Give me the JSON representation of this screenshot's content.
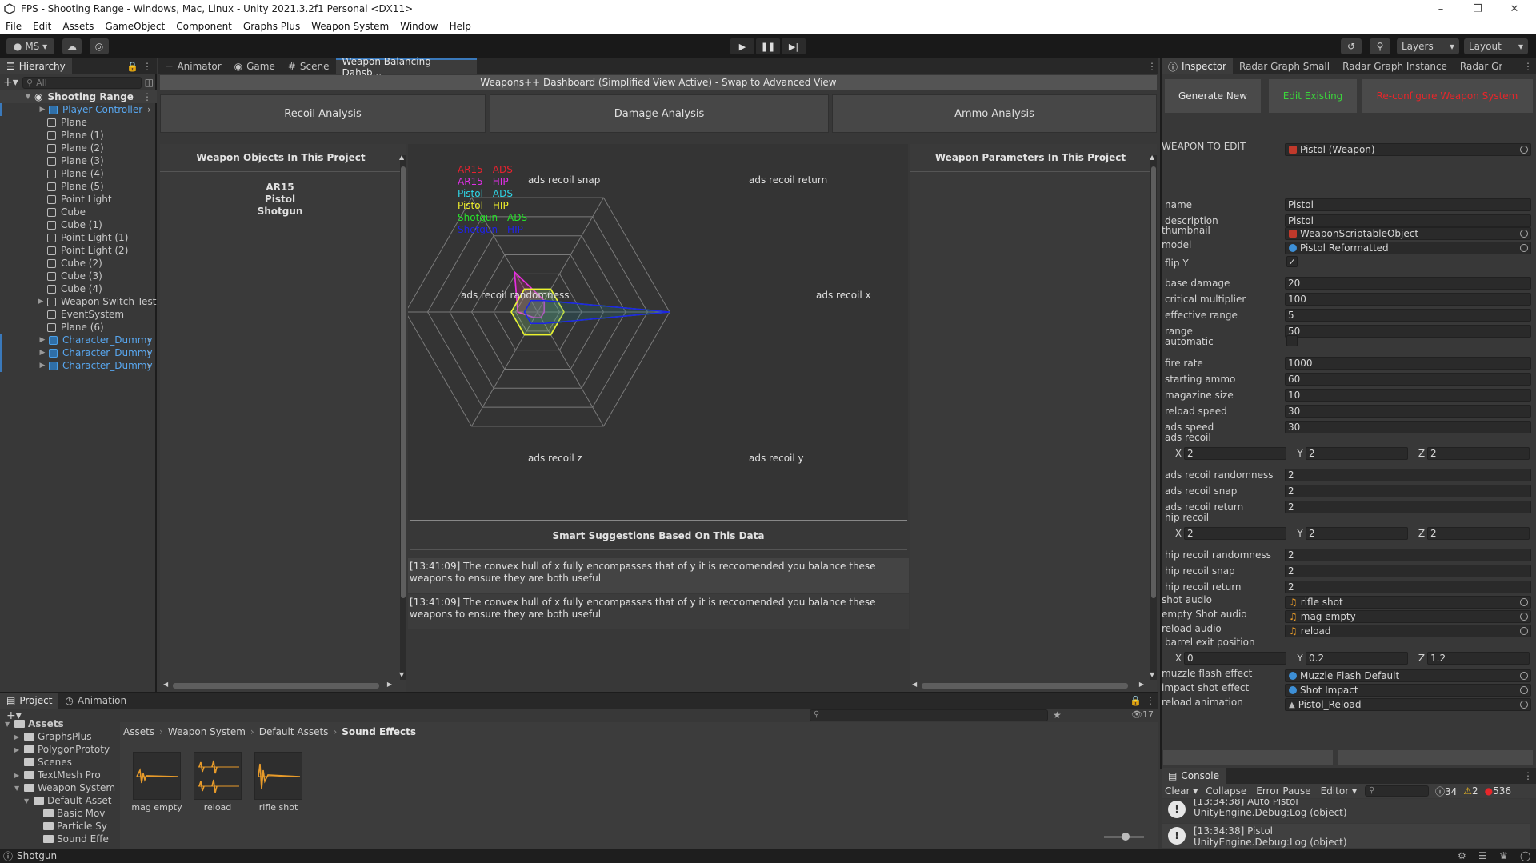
{
  "window": {
    "title": "FPS - Shooting Range - Windows, Mac, Linux - Unity 2021.3.2f1 Personal <DX11>",
    "controls": [
      "–",
      "❐",
      "✕"
    ]
  },
  "menu": [
    "File",
    "Edit",
    "Assets",
    "GameObject",
    "Component",
    "Graphs Plus",
    "Weapon System",
    "Window",
    "Help"
  ],
  "toolbar": {
    "account": "MS ▾",
    "layers": "Layers",
    "layout": "Layout"
  },
  "hierarchy": {
    "tab": "Hierarchy",
    "search_placeholder": "All",
    "root": "Shooting Range",
    "items": [
      {
        "label": "Player Controller",
        "blue": true,
        "arrow": true,
        "child": true
      },
      {
        "label": "Plane",
        "blue": false
      },
      {
        "label": "Plane (1)",
        "blue": false
      },
      {
        "label": "Plane (2)",
        "blue": false
      },
      {
        "label": "Plane (3)",
        "blue": false
      },
      {
        "label": "Plane (4)",
        "blue": false
      },
      {
        "label": "Plane (5)",
        "blue": false
      },
      {
        "label": "Point Light",
        "blue": false
      },
      {
        "label": "Cube",
        "blue": false
      },
      {
        "label": "Cube (1)",
        "blue": false
      },
      {
        "label": "Point Light (1)",
        "blue": false
      },
      {
        "label": "Point Light (2)",
        "blue": false
      },
      {
        "label": "Cube (2)",
        "blue": false
      },
      {
        "label": "Cube (3)",
        "blue": false
      },
      {
        "label": "Cube (4)",
        "blue": false
      },
      {
        "label": "Weapon Switch Test",
        "blue": false,
        "arrow": true
      },
      {
        "label": "EventSystem",
        "blue": false
      },
      {
        "label": "Plane (6)",
        "blue": false
      },
      {
        "label": "Character_Dummy",
        "blue": true,
        "arrow": true,
        "child": true
      },
      {
        "label": "Character_Dummy",
        "blue": true,
        "arrow": true,
        "child": true
      },
      {
        "label": "Character_Dummy",
        "blue": true,
        "arrow": true,
        "child": true
      }
    ]
  },
  "center_tabs": [
    "Animator",
    "Game",
    "Scene",
    "Weapon Balancing Dahsb..."
  ],
  "dashboard": {
    "banner": "Weapons++ Dashboard (Simplified View Active) - Swap to Advanced View",
    "buttons": [
      "Recoil Analysis",
      "Damage Analysis",
      "Ammo Analysis"
    ],
    "left_header": "Weapon Objects In This Project",
    "weapons": [
      "AR15",
      "Pistol",
      "Shotgun"
    ],
    "right_header": "Weapon Parameters In This Project",
    "suggest_header": "Smart Suggestions Based On This Data",
    "suggestions": [
      "[13:41:09] The convex hull of x fully encompasses that of y it is reccomended you balance these weapons to ensure they are both useful",
      "[13:41:09] The convex hull of x fully encompasses that of y it is reccomended you balance these weapons to ensure they are both useful"
    ]
  },
  "chart_data": {
    "type": "radar",
    "axes": [
      "ads recoil snap",
      "ads recoil return",
      "ads recoil x",
      "ads recoil y",
      "ads recoil z",
      "ads recoil randomness"
    ],
    "rmax": 10,
    "rings": 6,
    "series": [
      {
        "name": "AR15 - ADS",
        "color": "#e8222f",
        "values": [
          3.5,
          1.0,
          0.5,
          0.5,
          0.5,
          1.5
        ]
      },
      {
        "name": "AR15 - HIP",
        "color": "#e02fe8",
        "values": [
          3.5,
          1.0,
          0.5,
          0.5,
          0.5,
          1.5
        ]
      },
      {
        "name": "Pistol - ADS",
        "color": "#2fd7e8",
        "values": [
          2,
          2,
          2,
          2,
          2,
          2
        ]
      },
      {
        "name": "Pistol - HIP",
        "color": "#f0f02a",
        "values": [
          2,
          2,
          2,
          2,
          2,
          2
        ]
      },
      {
        "name": "Shotgun - ADS",
        "color": "#27e02a",
        "values": [
          1,
          1,
          10,
          1,
          1,
          1
        ]
      },
      {
        "name": "Shotgun - HIP",
        "color": "#1f22e6",
        "values": [
          1,
          1,
          10,
          1,
          1,
          1
        ]
      }
    ]
  },
  "inspector": {
    "tabs": [
      "Inspector",
      "Radar Graph Small",
      "Radar Graph Instance",
      "Radar Grap"
    ],
    "buttons": {
      "generate": "Generate New",
      "edit": "Edit Existing",
      "reconfig": "Re-configure Weapon System"
    },
    "weapon_to_edit_label": "WEAPON TO EDIT",
    "weapon_to_edit_value": "Pistol (Weapon)",
    "fields": [
      {
        "label": "name",
        "value": "Pistol"
      },
      {
        "label": "description",
        "value": "Pistol"
      },
      {
        "label": "base damage",
        "value": "20"
      },
      {
        "label": "critical multiplier",
        "value": "100"
      },
      {
        "label": "effective range",
        "value": "5"
      },
      {
        "label": "range",
        "value": "50"
      },
      {
        "label": "fire rate",
        "value": "1000"
      },
      {
        "label": "starting ammo",
        "value": "60"
      },
      {
        "label": "magazine size",
        "value": "10"
      },
      {
        "label": "reload speed",
        "value": "30"
      },
      {
        "label": "ads speed",
        "value": "30"
      },
      {
        "label": "ads recoil randomness",
        "value": "2"
      },
      {
        "label": "ads recoil snap",
        "value": "2"
      },
      {
        "label": "ads recoil return",
        "value": "2"
      },
      {
        "label": "hip recoil randomness",
        "value": "2"
      },
      {
        "label": "hip recoil snap",
        "value": "2"
      },
      {
        "label": "hip recoil return",
        "value": "2"
      }
    ],
    "thumbnail": {
      "label": "thumbnail",
      "value": "WeaponScriptableObject"
    },
    "model": {
      "label": "model",
      "value": "Pistol Reformatted"
    },
    "flipy": {
      "label": "flip Y",
      "checked": true
    },
    "automatic": {
      "label": "automatic",
      "checked": false
    },
    "ads_recoil": {
      "label": "ads recoil",
      "x": "2",
      "y": "2",
      "z": "2"
    },
    "hip_recoil": {
      "label": "hip recoil",
      "x": "2",
      "y": "2",
      "z": "2"
    },
    "audio": [
      {
        "label": "shot audio",
        "value": "rifle shot"
      },
      {
        "label": "empty Shot audio",
        "value": "mag empty"
      },
      {
        "label": "reload audio",
        "value": "reload"
      }
    ],
    "barrel": {
      "label": "barrel exit position",
      "x": "0",
      "y": "0.2",
      "z": "1.2"
    },
    "effects": [
      {
        "label": "muzzle flash effect",
        "value": "Muzzle Flash Default"
      },
      {
        "label": "impact shot effect",
        "value": "Shot Impact"
      },
      {
        "label": "reload animation",
        "value": "Pistol_Reload"
      }
    ]
  },
  "console": {
    "tab": "Console",
    "clear": "Clear",
    "collapse": "Collapse",
    "error_pause": "Error Pause",
    "editor": "Editor ▾",
    "counts": {
      "log": "34",
      "warn": "2",
      "error": "536"
    },
    "entries": [
      {
        "l1": "[13:34:38] Auto Pistol",
        "l2": "UnityEngine.Debug:Log (object)"
      },
      {
        "l1": "[13:34:38] Pistol",
        "l2": "UnityEngine.Debug:Log (object)"
      }
    ]
  },
  "project": {
    "tabs": [
      "Project",
      "Animation"
    ],
    "tree": [
      {
        "label": "Assets",
        "indent": 0
      },
      {
        "label": "GraphsPlus",
        "indent": 1
      },
      {
        "label": "PolygonPrototy",
        "indent": 1
      },
      {
        "label": "Scenes",
        "indent": 1
      },
      {
        "label": "TextMesh Pro",
        "indent": 1
      },
      {
        "label": "Weapon System",
        "indent": 1
      },
      {
        "label": "Default Asset",
        "indent": 2
      },
      {
        "label": "Basic Mov",
        "indent": 3
      },
      {
        "label": "Particle Sy",
        "indent": 3
      },
      {
        "label": "Sound Effe",
        "indent": 3
      }
    ],
    "breadcrumb": [
      "Assets",
      "Weapon System",
      "Default Assets",
      "Sound Effects"
    ],
    "assets": [
      "mag empty",
      "reload",
      "rifle shot"
    ],
    "hidden_count": "17"
  },
  "status": {
    "text": "Shotgun"
  }
}
